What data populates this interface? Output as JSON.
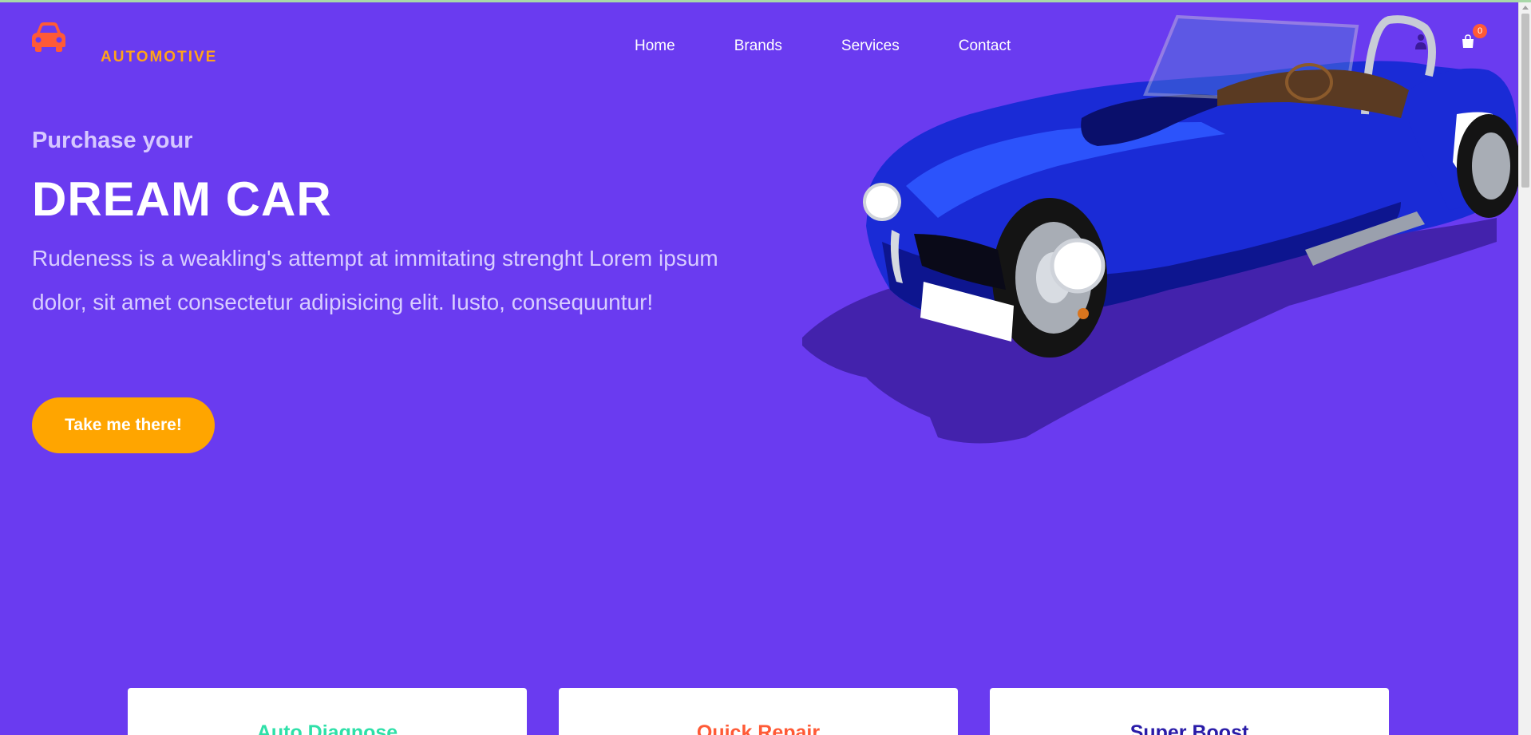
{
  "brand": {
    "name": "AUTOMOTIVE",
    "logo_icon": "car-icon",
    "accent": "#ffa31a"
  },
  "nav": {
    "items": [
      {
        "label": "Home"
      },
      {
        "label": "Brands"
      },
      {
        "label": "Services"
      },
      {
        "label": "Contact"
      }
    ],
    "user_icon": "user-icon",
    "cart_icon": "shopping-bag-icon",
    "cart_count": "0"
  },
  "hero": {
    "subtitle": "Purchase your",
    "title": "DREAM CAR",
    "text": "Rudeness is a weakling's attempt at immitating strenght Lorem ipsum dolor, sit amet consectetur adipisicing elit. Iusto, consequuntur!",
    "cta_label": "Take me there!",
    "background": "#6a3bf0",
    "cta_color": "#ffa500"
  },
  "cards": [
    {
      "title": "Auto Diagnose",
      "color": "#2ee0a8"
    },
    {
      "title": "Quick Repair",
      "color": "#ff5a36"
    },
    {
      "title": "Super Boost",
      "color": "#2a1ca8"
    }
  ]
}
